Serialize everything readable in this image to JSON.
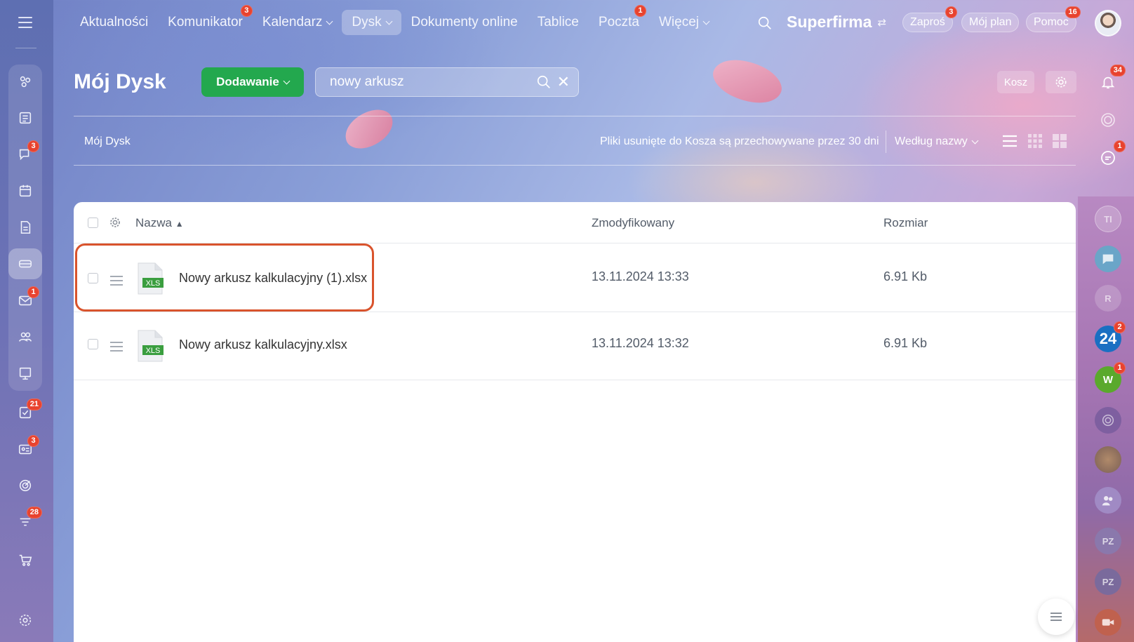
{
  "top_nav": {
    "items": [
      {
        "label": "Aktualności"
      },
      {
        "label": "Komunikator",
        "badge": "3"
      },
      {
        "label": "Kalendarz"
      },
      {
        "label": "Dysk"
      },
      {
        "label": "Dokumenty online"
      },
      {
        "label": "Tablice"
      },
      {
        "label": "Poczta",
        "badge": "1"
      },
      {
        "label": "Więcej"
      }
    ],
    "brand": "Superfirma",
    "invite": {
      "label": "Zaproś",
      "badge": "3"
    },
    "my_plan": "Mój plan",
    "help": {
      "label": "Pomoc",
      "badge": "16"
    }
  },
  "left_sidebar": {
    "badges": {
      "messenger": "3",
      "mail": "1",
      "tasks": "21",
      "crm": "3",
      "funnel": "28"
    }
  },
  "header": {
    "title": "Mój Dysk",
    "add_button": "Dodawanie",
    "search": {
      "value": "nowy arkusz",
      "placeholder": ""
    },
    "trash_button": "Kosz"
  },
  "toolbar": {
    "breadcrumb": "Mój Dysk",
    "trash_note": "Pliki usunięte do Kosza są przechowywane przez 30 dni",
    "sort_label": "Według nazwy"
  },
  "table": {
    "columns": {
      "name": "Nazwa",
      "modified": "Zmodyfikowany",
      "size": "Rozmiar"
    },
    "rows": [
      {
        "name": "Nowy arkusz kalkulacyjny (1).xlsx",
        "modified": "13.11.2024 13:33",
        "size": "6.91 Kb",
        "icon_label": "XLS"
      },
      {
        "name": "Nowy arkusz kalkulacyjny.xlsx",
        "modified": "13.11.2024 13:32",
        "size": "6.91 Kb",
        "icon_label": "XLS"
      }
    ]
  },
  "right_sidebar": {
    "notifications_badge": "34",
    "chat_badge": "1",
    "avatars": [
      {
        "initials": "TI"
      },
      {
        "initials": "R"
      },
      {
        "initials": "24",
        "badge": "2"
      },
      {
        "initials": "W",
        "badge": "1"
      },
      {
        "initials": "PZ"
      },
      {
        "initials": "PZ"
      }
    ]
  },
  "colors": {
    "accent_green": "#23a84e",
    "badge_red": "#e8432f",
    "highlight": "#d9532c"
  }
}
